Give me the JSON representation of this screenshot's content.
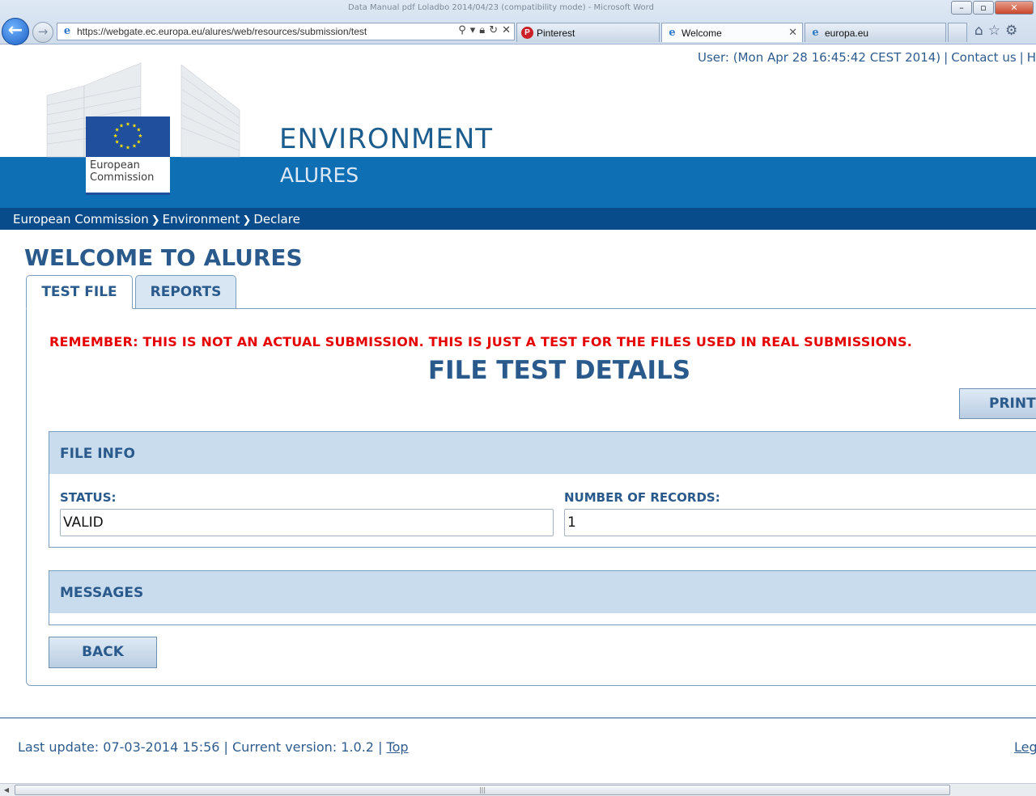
{
  "browser": {
    "window_title": "Data Manual pdf Loladbo 2014/04/23 (compatibility mode) - Microsoft Word",
    "address_url": "https://webgate.ec.europa.eu/alures/web/resources/submission/test",
    "tabs": [
      {
        "label": "Pinterest",
        "icon": "pinterest-icon"
      },
      {
        "label": "Welcome",
        "icon": "ie-page-icon",
        "active": true
      },
      {
        "label": "europa.eu",
        "icon": "ie-page-icon"
      }
    ]
  },
  "header": {
    "user_text": "User: (Mon Apr 28 16:45:42 CEST 2014)",
    "contact_link": "Contact us",
    "help_link_partial": "H",
    "logo_text": "European Commission",
    "site_title": "ENVIRONMENT",
    "site_subtitle": "ALURES",
    "colors": {
      "banner": "#0e6fb5",
      "breadcrumb_bar": "#084c8c",
      "heading": "#2a5a8c",
      "warning": "#e60000"
    }
  },
  "breadcrumb": [
    "European Commission",
    "Environment",
    "Declare"
  ],
  "main": {
    "title": "WELCOME TO ALURES",
    "tabs": [
      {
        "label": "TEST FILE",
        "active": true
      },
      {
        "label": "REPORTS",
        "active": false
      }
    ],
    "warning": "REMEMBER: THIS IS NOT AN ACTUAL SUBMISSION. THIS IS JUST A TEST FOR THE FILES USED IN REAL SUBMISSIONS.",
    "details_title": "FILE TEST DETAILS",
    "print_label": "PRINT",
    "file_info": {
      "heading": "FILE INFO",
      "status_label": "STATUS:",
      "status_value": "VALID",
      "records_label": "NUMBER OF RECORDS:",
      "records_value": "1"
    },
    "messages_heading": "MESSAGES",
    "back_label": "BACK"
  },
  "footer": {
    "last_update": "Last update: 07-03-2014 15:56 | Current version: 1.0.2 |",
    "top_link": "Top",
    "legal_partial": "Leg"
  }
}
